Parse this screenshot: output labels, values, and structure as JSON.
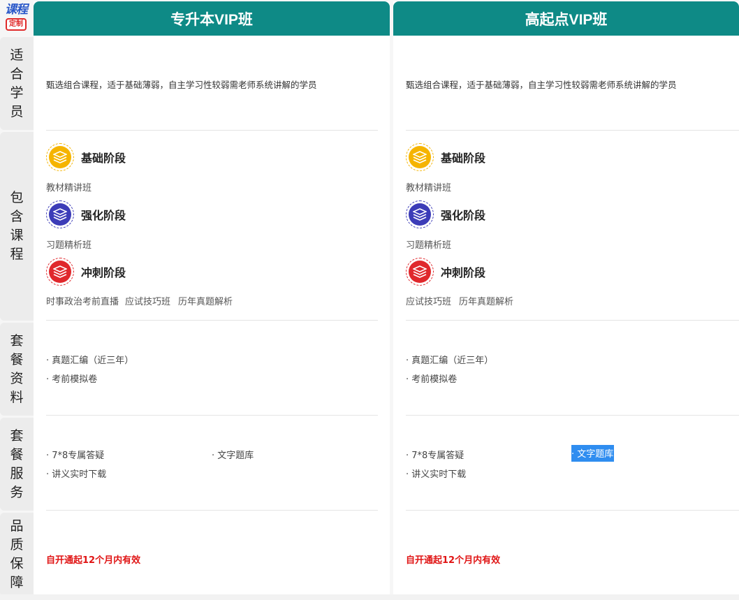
{
  "logo": {
    "line1": "课程",
    "line2": "定制"
  },
  "row_labels": [
    "适合学员",
    "包含课程",
    "套餐资料",
    "套餐服务",
    "品质保障"
  ],
  "columns": [
    {
      "title": "专升本VIP班",
      "suitable": "甄选组合课程，适于基础薄弱，自主学习性较弱需老师系统讲解的学员",
      "stages": [
        {
          "title": "基础阶段",
          "icon": "layers-icon",
          "color": "#f5b400",
          "courses": [
            "教材精讲班"
          ]
        },
        {
          "title": "强化阶段",
          "icon": "layers-icon",
          "color": "#3c3cb8",
          "courses": [
            "习题精析班"
          ]
        },
        {
          "title": "冲刺阶段",
          "icon": "layers-icon",
          "color": "#e0282c",
          "courses": [
            "时事政治考前直播",
            "应试技巧班",
            "历年真题解析"
          ]
        }
      ],
      "materials": [
        "· 真题汇编（近三年）",
        "· 考前模拟卷"
      ],
      "services": [
        "· 7*8专属答疑",
        "· 文字题库",
        "· 讲义实时下载"
      ],
      "validity": "自开通起12个月内有效"
    },
    {
      "title": "高起点VIP班",
      "suitable": "甄选组合课程，适于基础薄弱，自主学习性较弱需老师系统讲解的学员",
      "stages": [
        {
          "title": "基础阶段",
          "icon": "layers-icon",
          "color": "#f5b400",
          "courses": [
            "教材精讲班"
          ]
        },
        {
          "title": "强化阶段",
          "icon": "layers-icon",
          "color": "#3c3cb8",
          "courses": [
            "习题精析班"
          ]
        },
        {
          "title": "冲刺阶段",
          "icon": "layers-icon",
          "color": "#e0282c",
          "courses": [
            "应试技巧班",
            "历年真题解析"
          ]
        }
      ],
      "materials": [
        "· 真题汇编（近三年）",
        "· 考前模拟卷"
      ],
      "services": [
        "· 7*8专属答疑",
        "· 文字题库",
        "· 讲义实时下载"
      ],
      "validity": "自开通起12个月内有效"
    }
  ],
  "colors": {
    "header": "#0e8a86",
    "validity": "#e01414",
    "highlight": "#2f8df0"
  }
}
